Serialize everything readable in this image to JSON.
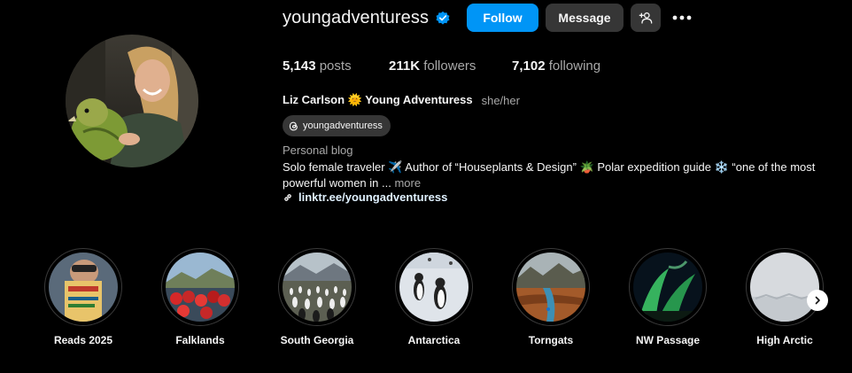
{
  "profile": {
    "username": "youngadventuress",
    "full_name": "Liz Carlson 🌞 Young Adventuress",
    "pronouns": "she/her",
    "threads_handle": "youngadventuress",
    "category": "Personal blog",
    "bio_line": "Solo female traveler ✈️  Author of “Houseplants & Design” 🪴 Polar expedition guide  ❄️  “one of the most powerful women in ... ",
    "bio_more": "more",
    "link": "linktr.ee/youngadventuress"
  },
  "actions": {
    "follow_label": "Follow",
    "message_label": "Message"
  },
  "stats": {
    "posts_count": "5,143",
    "posts_label": "posts",
    "followers_count": "211K",
    "followers_label": "followers",
    "following_count": "7,102",
    "following_label": "following"
  },
  "highlights": [
    {
      "label": "Reads 2025"
    },
    {
      "label": "Falklands"
    },
    {
      "label": "South Georgia"
    },
    {
      "label": "Antarctica"
    },
    {
      "label": "Torngats"
    },
    {
      "label": "NW Passage"
    },
    {
      "label": "High Arctic"
    }
  ],
  "colors": {
    "background": "#000000",
    "follow_button": "#0095f6",
    "secondary_button": "#363636",
    "muted_text": "#a8a8a8",
    "verified_badge": "#0095f6"
  },
  "icons": {
    "verified": "verified-badge-icon",
    "suggest": "add-person-icon",
    "more": "ellipsis-icon",
    "threads": "threads-icon",
    "link": "link-icon",
    "next": "chevron-right-icon"
  }
}
